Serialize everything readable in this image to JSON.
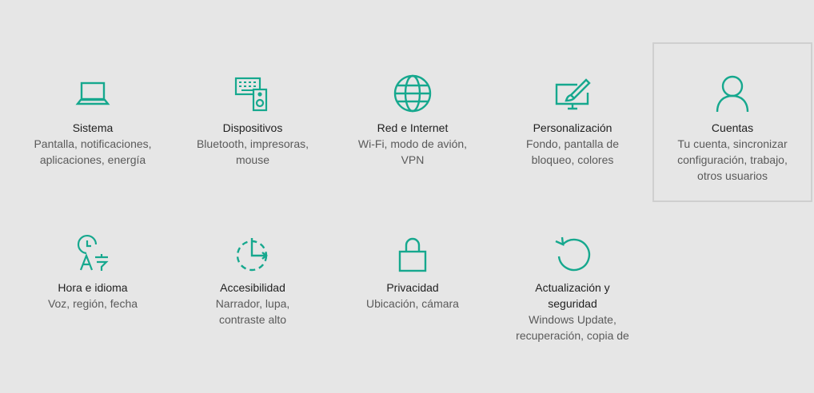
{
  "colors": {
    "accent": "#16a88e",
    "background": "#e6e6e6",
    "selected_border": "#cfcfcf"
  },
  "tiles": [
    {
      "icon": "laptop-icon",
      "title": "Sistema",
      "desc": [
        "Pantalla, notificaciones,",
        "aplicaciones, energía"
      ]
    },
    {
      "icon": "devices-icon",
      "title": "Dispositivos",
      "desc": [
        "Bluetooth, impresoras,",
        "mouse"
      ]
    },
    {
      "icon": "globe-icon",
      "title": "Red e Internet",
      "desc": [
        "Wi-Fi, modo de avión,",
        "VPN"
      ]
    },
    {
      "icon": "personalization-icon",
      "title": "Personalización",
      "desc": [
        "Fondo, pantalla de",
        "bloqueo, colores"
      ]
    },
    {
      "icon": "user-icon",
      "title": "Cuentas",
      "desc": [
        "Tu cuenta, sincronizar",
        "configuración, trabajo,",
        "otros usuarios"
      ]
    },
    {
      "icon": "time-language-icon",
      "title": "Hora e idioma",
      "desc": [
        "Voz, región, fecha"
      ]
    },
    {
      "icon": "ease-of-access-icon",
      "title": "Accesibilidad",
      "desc": [
        "Narrador, lupa,",
        "contraste alto"
      ]
    },
    {
      "icon": "lock-icon",
      "title": "Privacidad",
      "desc": [
        "Ubicación, cámara"
      ]
    },
    {
      "icon": "refresh-icon",
      "title": "Actualización y seguridad",
      "title_lines": [
        "Actualización y",
        "seguridad"
      ],
      "desc": [
        "Windows Update,",
        "recuperación, copia de"
      ]
    }
  ]
}
